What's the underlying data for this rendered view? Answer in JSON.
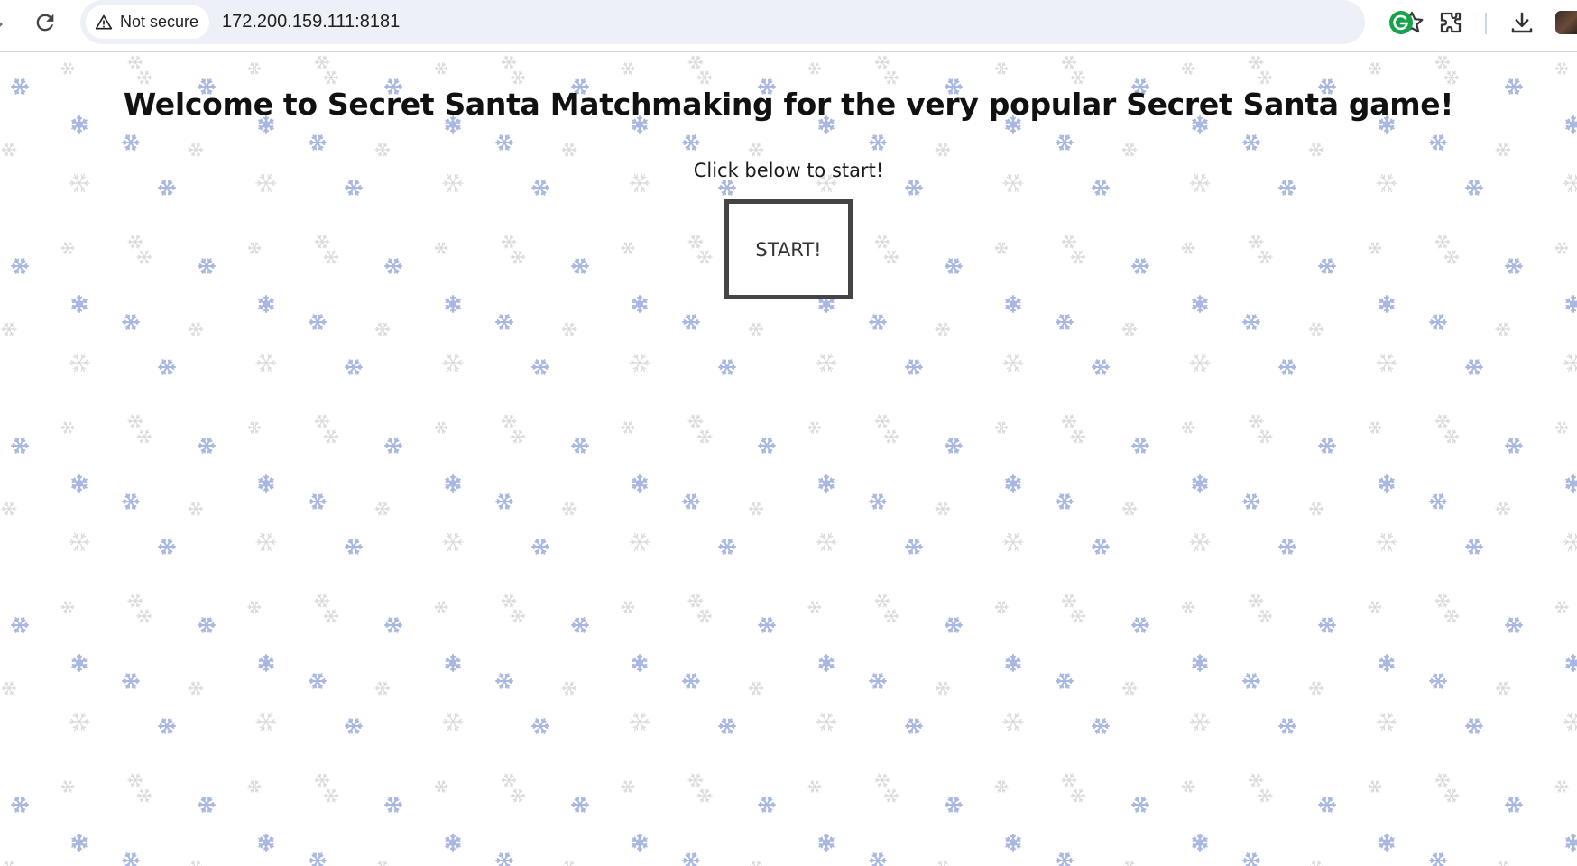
{
  "browser": {
    "security_label": "Not secure",
    "url": "172.200.159.111:8181",
    "icons": [
      "back-arrow-icon",
      "reload-icon",
      "warning-icon",
      "star-icon",
      "grammarly-icon",
      "extensions-icon",
      "download-icon",
      "profile-avatar"
    ]
  },
  "page": {
    "title": "Welcome to Secret Santa Matchmaking for the very popular Secret Santa game!",
    "subtitle": "Click below to start!",
    "start_label": "START!"
  },
  "colors": {
    "snowflake": "#a9b8e3",
    "snowflake_faint": "#d9d9d9",
    "button_border": "#444444",
    "grammarly": "#15a34a"
  }
}
